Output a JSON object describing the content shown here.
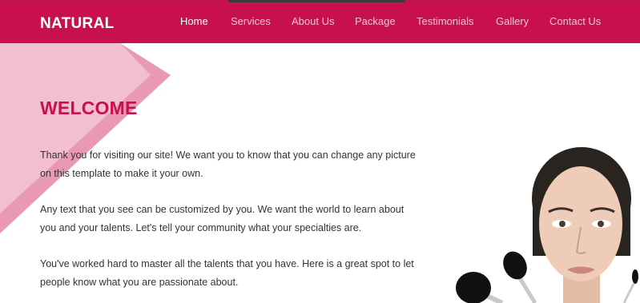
{
  "brand": "NATURAL",
  "nav": {
    "items": [
      {
        "label": "Home",
        "active": true
      },
      {
        "label": "Services",
        "active": false
      },
      {
        "label": "About Us",
        "active": false
      },
      {
        "label": "Package",
        "active": false
      },
      {
        "label": "Testimonials",
        "active": false
      },
      {
        "label": "Gallery",
        "active": false
      },
      {
        "label": "Contact Us",
        "active": false
      }
    ]
  },
  "main": {
    "heading": "WELCOME",
    "paragraphs": [
      "Thank you for visiting our site! We want you to know that you can change any picture on this template to make it your own.",
      "Any text that you see can be customized by you. We want the world to learn about you and your talents. Let's tell your community what your specialties are.",
      "You've worked hard to master all the talents that you have. Here is a great spot to let people know what you are passionate about."
    ]
  },
  "colors": {
    "brand": "#c8104f",
    "nav_inactive": "#f3c2d2",
    "deco_light": "#f1bfd1",
    "deco_mid": "#e999b6"
  },
  "images": {
    "hero": "portrait-with-makeup-brushes"
  }
}
